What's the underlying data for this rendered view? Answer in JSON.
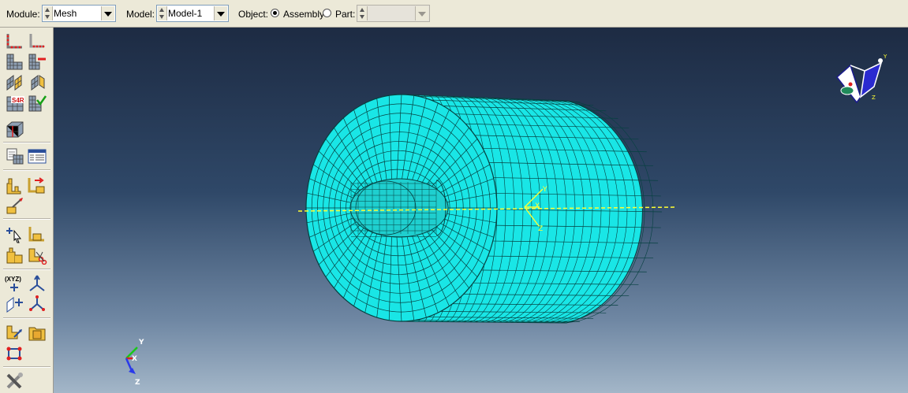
{
  "context_bar": {
    "module_label": "Module:",
    "module_value": "Mesh",
    "model_label": "Model:",
    "model_value": "Model-1",
    "object_label": "Object:",
    "assembly_label": "Assembly",
    "part_label": "Part:",
    "object_selected": "Assembly"
  },
  "toolbox": {
    "seed_text": "S4R",
    "xyz_text": "(XYZ)"
  },
  "viewport": {
    "mesh_color": "#19e6e6",
    "background_top": "#1d2b43",
    "background_bottom": "#a3b6c8",
    "datum_csys_labels": [
      "Y",
      "X",
      "Z"
    ],
    "triad_labels": [
      "Y",
      "X",
      "Z"
    ],
    "view_cube_labels": [
      "Y",
      "Z"
    ]
  }
}
